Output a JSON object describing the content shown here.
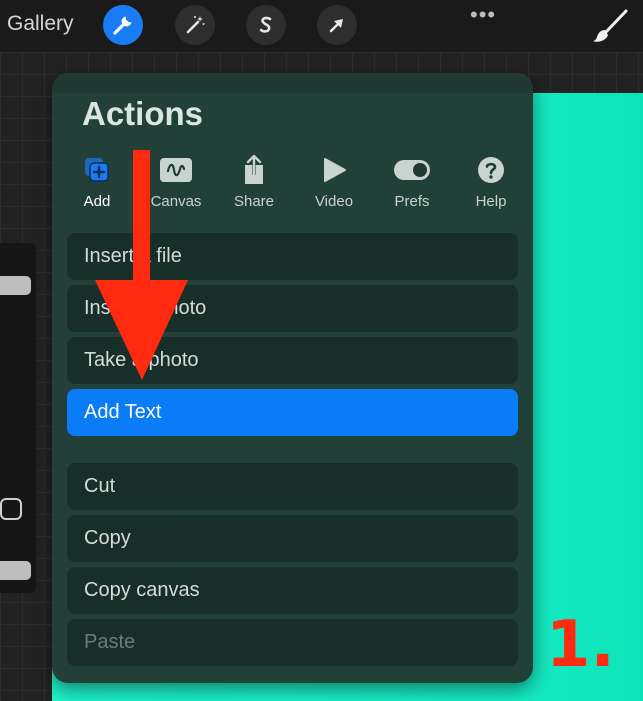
{
  "topbar": {
    "gallery_label": "Gallery",
    "tools": [
      {
        "name": "actions-wrench-icon",
        "active": true
      },
      {
        "name": "adjustments-wand-icon",
        "active": false
      },
      {
        "name": "selection-s-icon",
        "active": false
      },
      {
        "name": "transform-arrow-icon",
        "active": false
      }
    ],
    "more_label": "•••"
  },
  "panel": {
    "title": "Actions",
    "tabs": [
      {
        "label": "Add",
        "icon": "add-layers-icon",
        "active": true
      },
      {
        "label": "Canvas",
        "icon": "canvas-icon",
        "active": false
      },
      {
        "label": "Share",
        "icon": "share-icon",
        "active": false
      },
      {
        "label": "Video",
        "icon": "play-icon",
        "active": false
      },
      {
        "label": "Prefs",
        "icon": "toggle-icon",
        "active": false
      },
      {
        "label": "Help",
        "icon": "help-icon",
        "active": false
      }
    ],
    "items": [
      {
        "label": "Insert a file",
        "state": "normal"
      },
      {
        "label": "Insert a photo",
        "state": "normal"
      },
      {
        "label": "Take a photo",
        "state": "normal"
      },
      {
        "label": "Add Text",
        "state": "highlight"
      },
      {
        "label": "Cut",
        "state": "normal"
      },
      {
        "label": "Copy",
        "state": "normal"
      },
      {
        "label": "Copy canvas",
        "state": "normal"
      },
      {
        "label": "Paste",
        "state": "disabled"
      }
    ]
  },
  "annotation": {
    "step_label": "1.",
    "arrow_color": "#ff2a10"
  },
  "colors": {
    "accent": "#1a7cf5",
    "canvas": "#1ff0c8",
    "panel": "#223a34"
  }
}
